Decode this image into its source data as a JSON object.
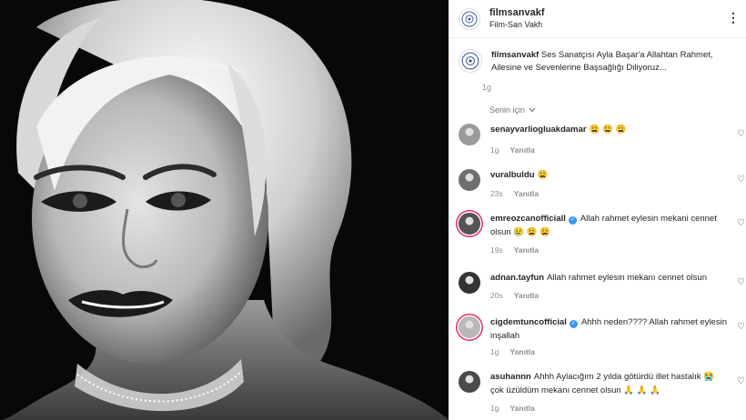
{
  "post": {
    "username": "filmsanvakf",
    "subtitle": "Film-San Vakfı",
    "more_icon": "more-icon",
    "caption_username": "filmsanvakf",
    "caption_text": "Ses Sanatçısı Ayla Başar'a Allahtan Rahmet, Ailesine ve Sevenlerine Başsağlığı Diliyoruz...",
    "caption_time": "1g"
  },
  "sort": {
    "label": "Senin için",
    "icon": "chevron-down-icon"
  },
  "comments": [
    {
      "username": "senayvarliogluakdamar",
      "verified": false,
      "text": "😩 😩 😩",
      "time": "1g",
      "reply": "Yanıtla"
    },
    {
      "username": "vuralbuldu",
      "verified": false,
      "text": "😩",
      "time": "23s",
      "reply": "Yanıtla"
    },
    {
      "username": "emreozcanofficiall",
      "verified": true,
      "text": "Allah rahmet eylesin mekani cennet olsun 😢 😩 😩",
      "time": "19s",
      "reply": "Yanıtla"
    },
    {
      "username": "adnan.tayfun",
      "verified": false,
      "text": "Allah rahmet eylesin mekanı cennet olsun",
      "time": "20s",
      "reply": "Yanıtla"
    },
    {
      "username": "cigdemtuncofficial",
      "verified": true,
      "text": "Ahhh neden???? Allah rahmet eylesin inşallah",
      "time": "1g",
      "reply": "Yanıtla"
    },
    {
      "username": "asuhannn",
      "verified": false,
      "text": "Ahhh Aylacığım 2 yılda götürdü illet hastalık 😭 çok üzüldüm mekanı cennet olsun 🙏 🙏 🙏",
      "time": "1g",
      "reply": "Yanıtla"
    }
  ],
  "colors": {
    "link": "#262626",
    "muted": "#8e8e8e",
    "verified": "#3897f0",
    "story_ring": "#e1306c"
  }
}
